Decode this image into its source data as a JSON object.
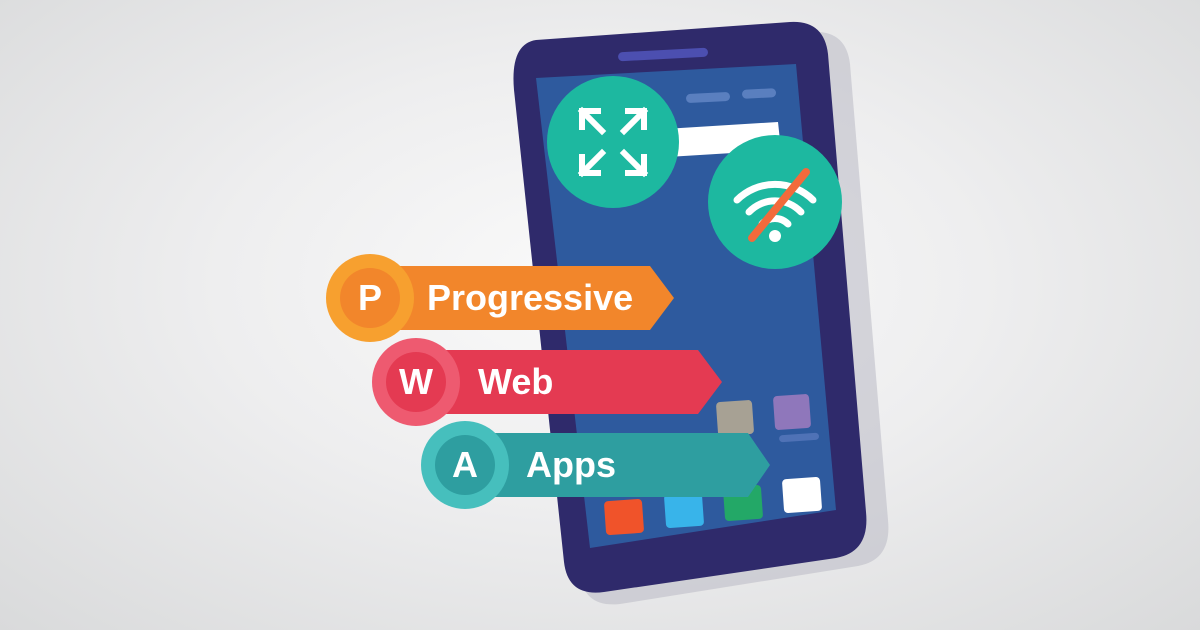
{
  "labels": {
    "progressive": {
      "letter": "P",
      "text": "Progressive"
    },
    "web": {
      "letter": "W",
      "text": "Web"
    },
    "apps": {
      "letter": "A",
      "text": "Apps"
    }
  },
  "icons": {
    "expand": "expand-arrows-icon",
    "no_wifi": "wifi-off-icon"
  },
  "colors": {
    "background": "#e8e8e9",
    "phone_body": "#2f2a6b",
    "phone_screen": "#2e5a9e",
    "phone_shadow": "#b9b9c2",
    "teal_circle": "#1db8a0",
    "slash": "#f26a3b",
    "progressive": "#f2862b",
    "progressive_badge": "#f7a02f",
    "web": "#e43a52",
    "web_badge": "#ee5a70",
    "apps": "#2e9ea0",
    "apps_badge": "#46bfbd"
  }
}
